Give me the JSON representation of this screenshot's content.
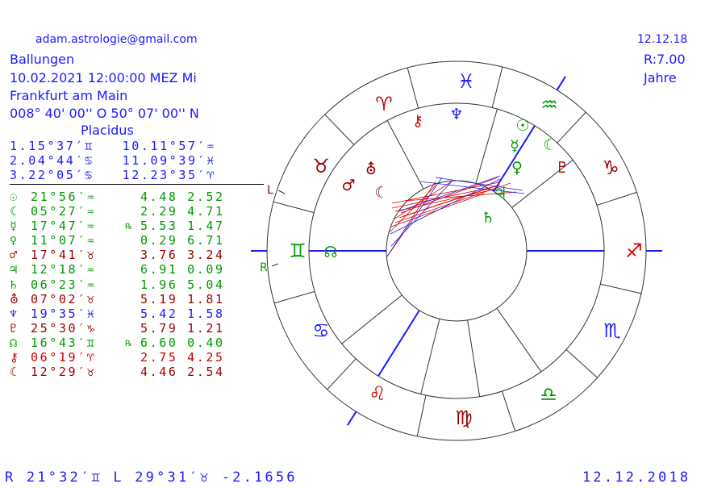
{
  "header": {
    "email": "adam.astrologie@gmail.com",
    "name": "Ballungen",
    "datetime": "10.02.2021   12:00:00  MEZ Mi",
    "place": "Frankfurt am Main",
    "coords": "008° 40' 00'' O    50° 07' 00'' N",
    "house_system": "Placidus"
  },
  "right_info": {
    "date": "12.12.18",
    "radius": "R:7.00",
    "unit": "Jahre"
  },
  "cusps": [
    {
      "left": "1.15°37′♊",
      "right": "10.11°57′♒"
    },
    {
      "left": "2.04°44′♋",
      "right": "11.09°39′♓"
    },
    {
      "left": "3.22°05′♋",
      "right": "12.23°35′♈"
    }
  ],
  "planets": [
    {
      "symbol": "☉",
      "pos": "21°56′♒",
      "retro": "",
      "vals": "4.48 2.52",
      "color": "#009900"
    },
    {
      "symbol": "☾",
      "pos": "05°27′♒",
      "retro": "",
      "vals": "2.29 4.71",
      "color": "#009900"
    },
    {
      "symbol": "☿",
      "pos": "17°47′♒",
      "retro": "℞",
      "vals": "5.53 1.47",
      "color": "#009900"
    },
    {
      "symbol": "♀",
      "pos": "11°07′♒",
      "retro": "",
      "vals": "0.29 6.71",
      "color": "#009900"
    },
    {
      "symbol": "♂",
      "pos": "17°41′♉",
      "retro": "",
      "vals": "3.76 3.24",
      "color": "#990000"
    },
    {
      "symbol": "♃",
      "pos": "12°18′♒",
      "retro": "",
      "vals": "6.91 0.09",
      "color": "#009900"
    },
    {
      "symbol": "♄",
      "pos": "06°23′♒",
      "retro": "",
      "vals": "1.96 5.04",
      "color": "#009900"
    },
    {
      "symbol": "⛢",
      "pos": "07°02′♉",
      "retro": "",
      "vals": "5.19 1.81",
      "color": "#990000"
    },
    {
      "symbol": "♆",
      "pos": "19°35′♓",
      "retro": "",
      "vals": "5.42 1.58",
      "color": "#1a1aff"
    },
    {
      "symbol": "♇",
      "pos": "25°30′♑",
      "retro": "",
      "vals": "5.79 1.21",
      "color": "#990000"
    },
    {
      "symbol": "☊",
      "pos": "16°43′♊",
      "retro": "℞",
      "vals": "6.60 0.40",
      "color": "#009900"
    },
    {
      "symbol": "⚷",
      "pos": "06°19′♈",
      "retro": "",
      "vals": "2.75 4.25",
      "color": "#cc0000"
    },
    {
      "symbol": "☾",
      "pos": "12°29′♉",
      "retro": "",
      "vals": "4.46 2.54",
      "color": "#990000"
    }
  ],
  "footer": {
    "left": "R 21°32′♊ L 29°31′♉  -2.1656",
    "right": "12.12.2018"
  },
  "wheel": {
    "markers": {
      "L": "L",
      "R": "R"
    },
    "signs": [
      {
        "glyph": "♓",
        "color": "#1a1aff"
      },
      {
        "glyph": "♈",
        "color": "#cc0000"
      },
      {
        "glyph": "♉",
        "color": "#990000"
      },
      {
        "glyph": "♊",
        "color": "#009900"
      },
      {
        "glyph": "♋",
        "color": "#1a1aff"
      },
      {
        "glyph": "♌",
        "color": "#cc0000"
      },
      {
        "glyph": "♍",
        "color": "#990000"
      },
      {
        "glyph": "♎",
        "color": "#009900"
      },
      {
        "glyph": "♏",
        "color": "#1a1aff"
      },
      {
        "glyph": "♐",
        "color": "#cc0000"
      },
      {
        "glyph": "♑",
        "color": "#990000"
      },
      {
        "glyph": "♒",
        "color": "#009900"
      }
    ],
    "planet_glyphs": [
      {
        "glyph": "⚷",
        "color": "#cc0000"
      },
      {
        "glyph": "♆",
        "color": "#1a1aff"
      },
      {
        "glyph": "☉",
        "color": "#009900"
      },
      {
        "glyph": "☿",
        "color": "#009900"
      },
      {
        "glyph": "☾",
        "color": "#009900"
      },
      {
        "glyph": "♀",
        "color": "#009900"
      },
      {
        "glyph": "♇",
        "color": "#990000"
      },
      {
        "glyph": "⛢",
        "color": "#990000"
      },
      {
        "glyph": "♂",
        "color": "#990000"
      },
      {
        "glyph": "☾",
        "color": "#990000"
      },
      {
        "glyph": "♃",
        "color": "#009900"
      },
      {
        "glyph": "♄",
        "color": "#009900"
      },
      {
        "glyph": "☊",
        "color": "#009900"
      }
    ]
  }
}
